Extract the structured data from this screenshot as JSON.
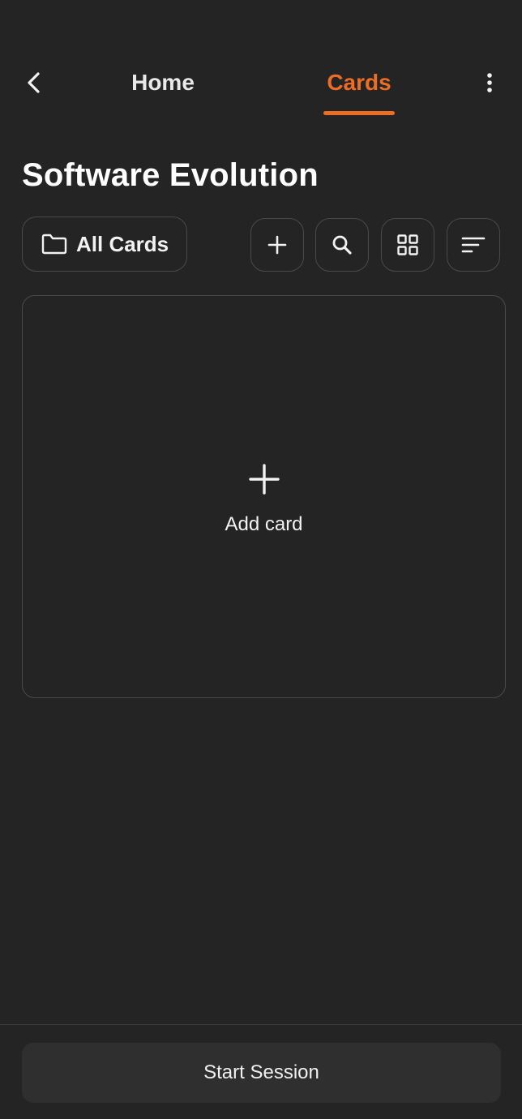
{
  "header": {
    "back_icon": "chevron-left-icon",
    "tabs": [
      {
        "label": "Home",
        "active": false
      },
      {
        "label": "Cards",
        "active": true
      }
    ],
    "more_icon": "vertical-ellipsis-icon",
    "accent_color": "#ed6d24"
  },
  "page": {
    "title": "Software Evolution"
  },
  "toolbar": {
    "folder_label": "All Cards",
    "folder_icon": "folder-icon",
    "tools": [
      "plus-icon",
      "search-icon",
      "grid-view-icon",
      "sort-icon"
    ]
  },
  "add_card": {
    "label": "Add card",
    "icon": "plus-icon"
  },
  "footer": {
    "start_label": "Start Session"
  },
  "colors": {
    "background": "#242424",
    "border": "#4a4a4a",
    "button_bg": "#2f2f2f",
    "text": "#f2f2f2"
  }
}
